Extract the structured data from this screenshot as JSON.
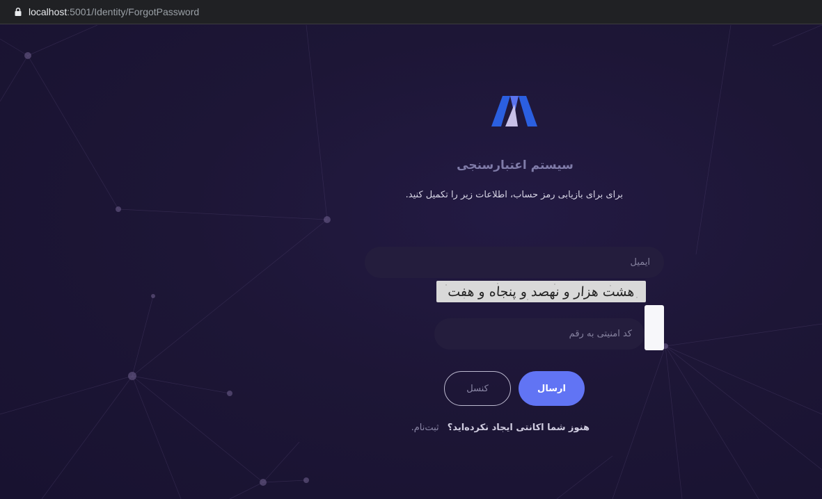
{
  "browser": {
    "url_host": "localhost",
    "url_path": ":5001/Identity/ForgotPassword"
  },
  "header": {
    "title": "سیستم اعتبارسنجی",
    "subtitle": "برای برای بازیابی رمز حساب، اطلاعات زیر را تکمیل کنید."
  },
  "form": {
    "email_placeholder": "ایمیل",
    "email_value": "",
    "captcha_text": "هشت هزار و نهصد و پنجاه و هفت",
    "security_placeholder": "کد امنیتی به رقم",
    "security_value": "",
    "submit_label": "ارسال",
    "cancel_label": "کنسل"
  },
  "footer": {
    "question": "هنوز شما اکانتی ایجاد نکرده‌اید؟",
    "signup_link": "ثبت‌نام."
  },
  "colors": {
    "background": "#1c1533",
    "input_bg": "#241d3d",
    "accent": "#6174f4"
  },
  "icons": [
    "lock-icon",
    "brand-logo",
    "captcha-refresh-icon"
  ]
}
